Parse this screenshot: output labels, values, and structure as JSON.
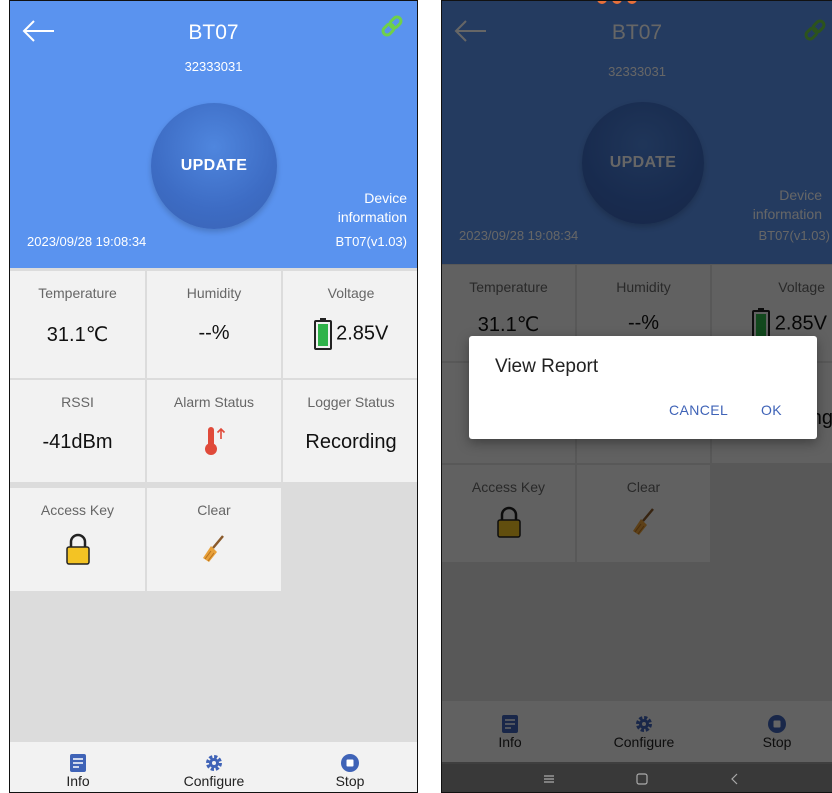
{
  "device": {
    "title": "BT07",
    "serial": "32333031",
    "update_label": "UPDATE",
    "info_line1": "Device",
    "info_line2": "information",
    "datetime": "2023/09/28  19:08:34",
    "version": "BT07(v1.03)"
  },
  "tiles": {
    "temperature_label": "Temperature",
    "temperature_value": "31.1℃",
    "humidity_label": "Humidity",
    "humidity_value": "--%",
    "voltage_label": "Voltage",
    "voltage_value": "2.85V",
    "rssi_label": "RSSI",
    "rssi_value": "-41dBm",
    "alarm_label": "Alarm Status",
    "logger_label": "Logger Status",
    "logger_value": "Recording",
    "access_label": "Access Key",
    "clear_label": "Clear"
  },
  "nav": {
    "info": "Info",
    "configure": "Configure",
    "stop": "Stop"
  },
  "dialog": {
    "title": "View Report",
    "cancel": "CANCEL",
    "ok": "OK"
  },
  "colors": {
    "header_blue": "#5a93ef",
    "accent": "#3f63b7",
    "battery_green": "#2fb34a",
    "lock_yellow": "#f3c324",
    "broom_orange": "#e8a13a",
    "thermometer_red": "#e04a3a"
  },
  "icons": {
    "back": "arrow-left-icon",
    "link": "link-icon",
    "battery": "battery-icon",
    "thermometer": "thermometer-alarm-icon",
    "lock": "lock-icon",
    "broom": "broom-icon",
    "info": "document-icon",
    "configure": "gear-icon",
    "stop": "stop-icon"
  }
}
